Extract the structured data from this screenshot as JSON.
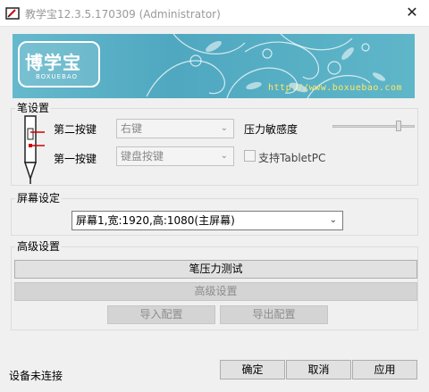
{
  "window": {
    "title": "教学宝12.3.5.170309 (Administrator)",
    "close_label": "✕"
  },
  "banner": {
    "logo_text": "博学宝",
    "logo_sub": "BOXUEBAO",
    "url": "http://www.boxuebao.com"
  },
  "pen_settings": {
    "title": "笔设置",
    "second_key_label": "第二按键",
    "second_key_value": "右键",
    "first_key_label": "第一按键",
    "first_key_value": "键盘按键",
    "pressure_label": "压力敏感度",
    "pressure_level": 0.83,
    "tabletpc_label": "支持TabletPC",
    "tabletpc_checked": false
  },
  "screen_settings": {
    "title": "屏幕设定",
    "selected_screen": "屏幕1,宽:1920,高:1080(主屏幕)"
  },
  "advanced_settings": {
    "title": "高级设置",
    "pressure_test_label": "笔压力测试",
    "advanced_label": "高级设置",
    "import_label": "导入配置",
    "export_label": "导出配置"
  },
  "footer": {
    "status": "设备未连接",
    "ok_label": "确定",
    "cancel_label": "取消",
    "apply_label": "应用"
  },
  "colors": {
    "banner_bg": "#4fa8c0",
    "url_text": "#ffe866",
    "pen_marker": "#d00000"
  }
}
